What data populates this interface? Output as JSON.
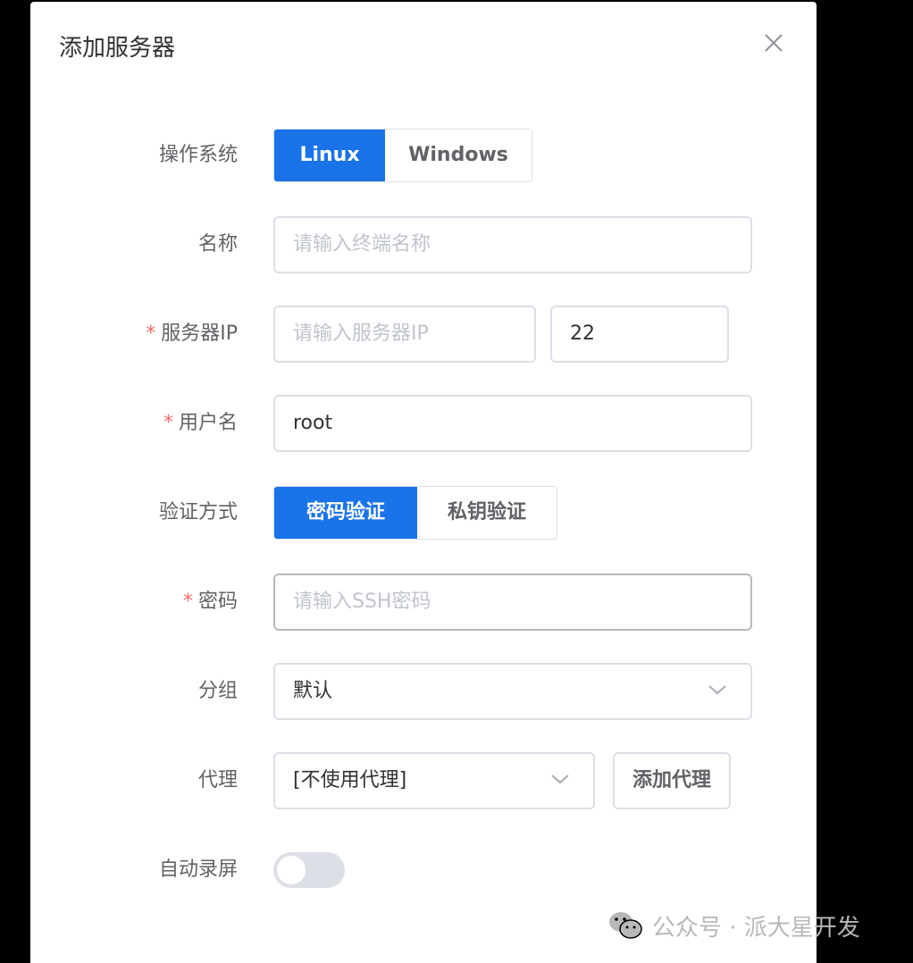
{
  "dialog": {
    "title": "添加服务器"
  },
  "form": {
    "os": {
      "label": "操作系统",
      "options": [
        "Linux",
        "Windows"
      ],
      "selected": "Linux"
    },
    "name": {
      "label": "名称",
      "placeholder": "请输入终端名称",
      "value": ""
    },
    "server_ip": {
      "required_mark": "*",
      "label": "服务器IP",
      "placeholder": "请输入服务器IP",
      "value": "",
      "port": "22"
    },
    "username": {
      "required_mark": "*",
      "label": "用户名",
      "value": "root"
    },
    "auth": {
      "label": "验证方式",
      "options": [
        "密码验证",
        "私钥验证"
      ],
      "selected": "密码验证"
    },
    "password": {
      "required_mark": "*",
      "label": "密码",
      "placeholder": "请输入SSH密码",
      "value": ""
    },
    "group": {
      "label": "分组",
      "value": "默认"
    },
    "proxy": {
      "label": "代理",
      "value": "[不使用代理]",
      "add_button": "添加代理"
    },
    "auto_record": {
      "label": "自动录屏",
      "enabled": false
    }
  },
  "watermark": {
    "text": "公众号 · 派大星开发"
  },
  "colors": {
    "primary": "#1a73e8",
    "required": "#f56c6c",
    "border": "#dcdfe6",
    "placeholder": "#c0c4cc"
  },
  "icons": {
    "close": "close-icon",
    "select_arrow": "chevron-down-icon",
    "watermark_logo": "wechat-icon"
  }
}
